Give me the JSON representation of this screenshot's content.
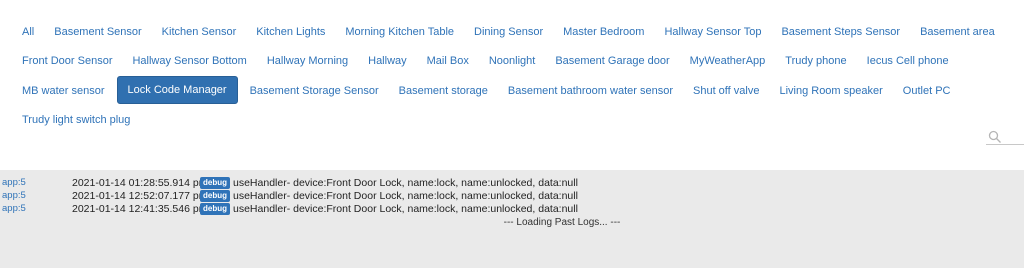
{
  "filters": [
    "All",
    "Basement Sensor",
    "Kitchen Sensor",
    "Kitchen Lights",
    "Morning Kitchen Table",
    "Dining Sensor",
    "Master Bedroom",
    "Hallway Sensor Top",
    "Basement Steps Sensor",
    "Basement area",
    "Front Door Sensor",
    "Hallway Sensor Bottom",
    "Hallway Morning",
    "Hallway",
    "Mail Box",
    "Noonlight",
    "Basement Garage door",
    "MyWeatherApp",
    "Trudy phone",
    "Iecus Cell phone",
    "MB water sensor",
    "Lock Code Manager",
    "Basement Storage Sensor",
    "Basement storage",
    "Basement bathroom water sensor",
    "Shut off valve",
    "Living Room speaker",
    "Outlet PC",
    "Trudy light switch plug"
  ],
  "active_filter": "Lock Code Manager",
  "search": {
    "placeholder": "",
    "value": "",
    "icon": "search-icon"
  },
  "logs": [
    {
      "app": "app:5",
      "time": "2021-01-14 01:28:55.914 pm",
      "level": "debug",
      "message": "useHandler- device:Front Door Lock, name:lock, name:unlocked, data:null"
    },
    {
      "app": "app:5",
      "time": "2021-01-14 12:52:07.177 pm",
      "level": "debug",
      "message": "useHandler- device:Front Door Lock, name:lock, name:unlocked, data:null"
    },
    {
      "app": "app:5",
      "time": "2021-01-14 12:41:35.546 pm",
      "level": "debug",
      "message": "useHandler- device:Front Door Lock, name:lock, name:unlocked, data:null"
    }
  ],
  "loading_text": "--- Loading Past Logs... ---",
  "colors": {
    "link": "#2f73b8",
    "active_bg": "#3070b0",
    "log_bg": "#eaeaea",
    "badge": "#2f73b8"
  }
}
